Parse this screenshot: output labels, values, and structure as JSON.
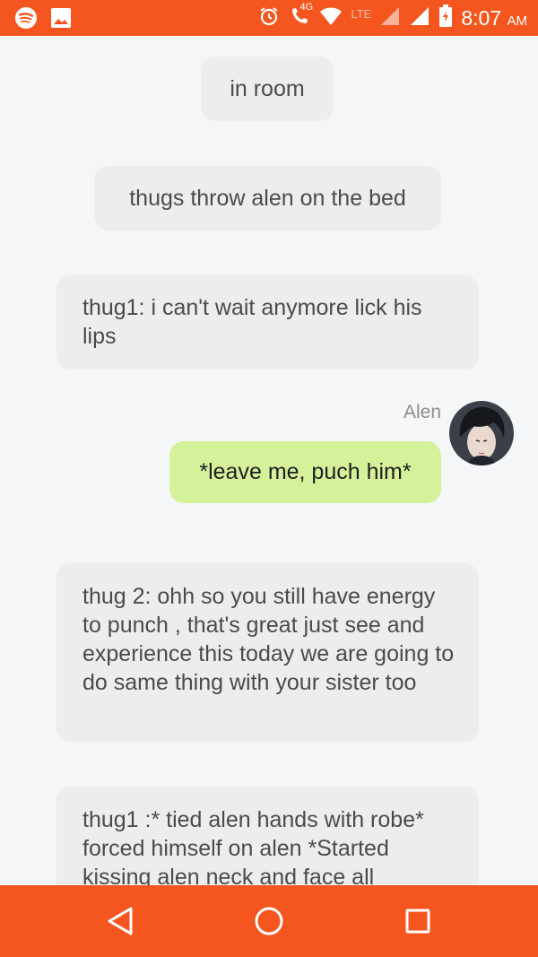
{
  "status_bar": {
    "time": "8:07",
    "ampm": "AM",
    "network_type": "LTE",
    "data_badge": "4G",
    "icons": [
      "spotify-icon",
      "image-icon",
      "alarm-icon",
      "volte-call-icon",
      "wifi-icon",
      "signal-icon",
      "battery-charging-icon"
    ]
  },
  "chat": {
    "messages": [
      {
        "text": "in room"
      },
      {
        "text": "thugs throw alen on the bed"
      },
      {
        "text": "thug1: i can't wait anymore lick his lips"
      },
      {
        "sender": "Alen",
        "text": "*leave me, puch him*"
      },
      {
        "text": "thug 2: ohh so you still have energy to punch , that's great just see and experience this today we are going to do same thing with your sister too"
      },
      {
        "text": "thug1 :* tied alen hands with robe* forced himself on alen *Started kissing alen neck and face all"
      }
    ]
  },
  "navigation": {
    "icons": [
      "back-icon",
      "home-icon",
      "recent-apps-icon"
    ]
  },
  "colors": {
    "accent": "#f5561f",
    "bot_bubble": "#ededed",
    "user_bubble": "#d5f29a",
    "background": "#f5f6f7"
  }
}
